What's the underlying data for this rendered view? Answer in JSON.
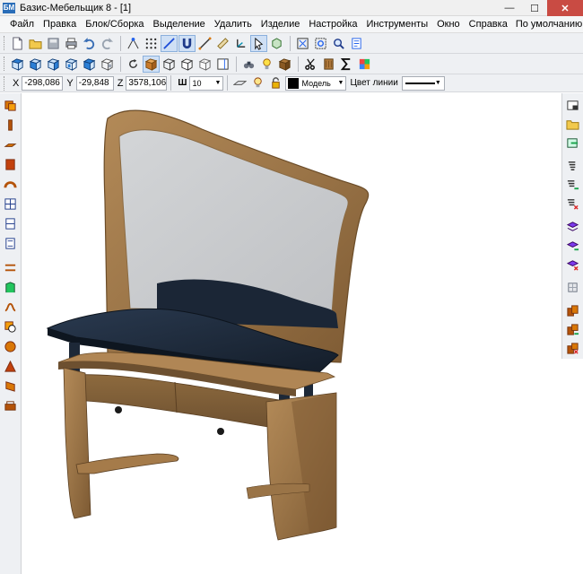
{
  "window": {
    "title": "Базис-Мебельщик 8 - [1]",
    "app_icon_text": "БМ",
    "minimize": "—",
    "maximize": "☐",
    "close": "✕"
  },
  "menu": {
    "items": [
      "Файл",
      "Правка",
      "Блок/Сборка",
      "Выделение",
      "Удалить",
      "Изделие",
      "Настройка",
      "Инструменты",
      "Окно",
      "Справка"
    ],
    "layout_preset": "По умолчанию"
  },
  "coords": {
    "x_label": "X",
    "x_value": "-298,086",
    "y_label": "Y",
    "y_value": "-29,848",
    "z_label": "Z",
    "z_value": "3578,106"
  },
  "props": {
    "step_icon": "Ш",
    "step_value": "10",
    "layer_value": "Модель",
    "line_color_label": "Цвет линии"
  },
  "colors": {
    "wood": "#9a7447",
    "mirror": "#c9cbcd",
    "tabletop": "#1f2b3b",
    "accent": "#2a6db8"
  },
  "icons": {
    "toolbar1": [
      "new-file-icon",
      "open-folder-icon",
      "save-icon",
      "print-icon",
      "undo-icon",
      "redo-icon",
      "snap-node-icon",
      "grid-snap-icon",
      "line-tool-icon",
      "magnet-icon",
      "measure-icon",
      "ruler-icon",
      "axis-icon",
      "select-cursor-icon",
      "3d-orbit-icon",
      "zoom-extents-icon",
      "zoom-window-icon",
      "zoom-icon",
      "properties-icon"
    ],
    "toolbar2": [
      "view-top-icon",
      "view-front-icon",
      "view-left-icon",
      "view-right-icon",
      "view-iso-icon",
      "view-back-icon",
      "rotate-view-icon",
      "shaded-icon",
      "wireframe-icon",
      "hidden-line-icon",
      "box-icon",
      "panel-icon",
      "render-icon",
      "light-icon",
      "material-icon",
      "cut-icon",
      "texture-icon",
      "sum-icon",
      "palette-icon"
    ],
    "left_toolbar": [
      "panel-horizontal-icon",
      "panel-vertical-icon",
      "panel-front-icon",
      "panel-box-icon",
      "bent-panel-icon",
      "door-icon",
      "drawer-icon",
      "frame-icon",
      "shelf-icon",
      "profile-icon",
      "curve-icon",
      "hole-icon",
      "sphere-icon",
      "pyramid-icon",
      "cut-panel-icon",
      "fastener-icon"
    ],
    "right_toolbar": [
      "window-layout-icon",
      "folder-icon",
      "export-icon",
      "screw-icon",
      "screw-add-icon",
      "screw-remove-icon",
      "layer-icon",
      "layer-add-icon",
      "layer-remove-icon",
      "group-icon",
      "assembly-icon",
      "assembly-add-icon",
      "assembly-remove-icon"
    ]
  }
}
